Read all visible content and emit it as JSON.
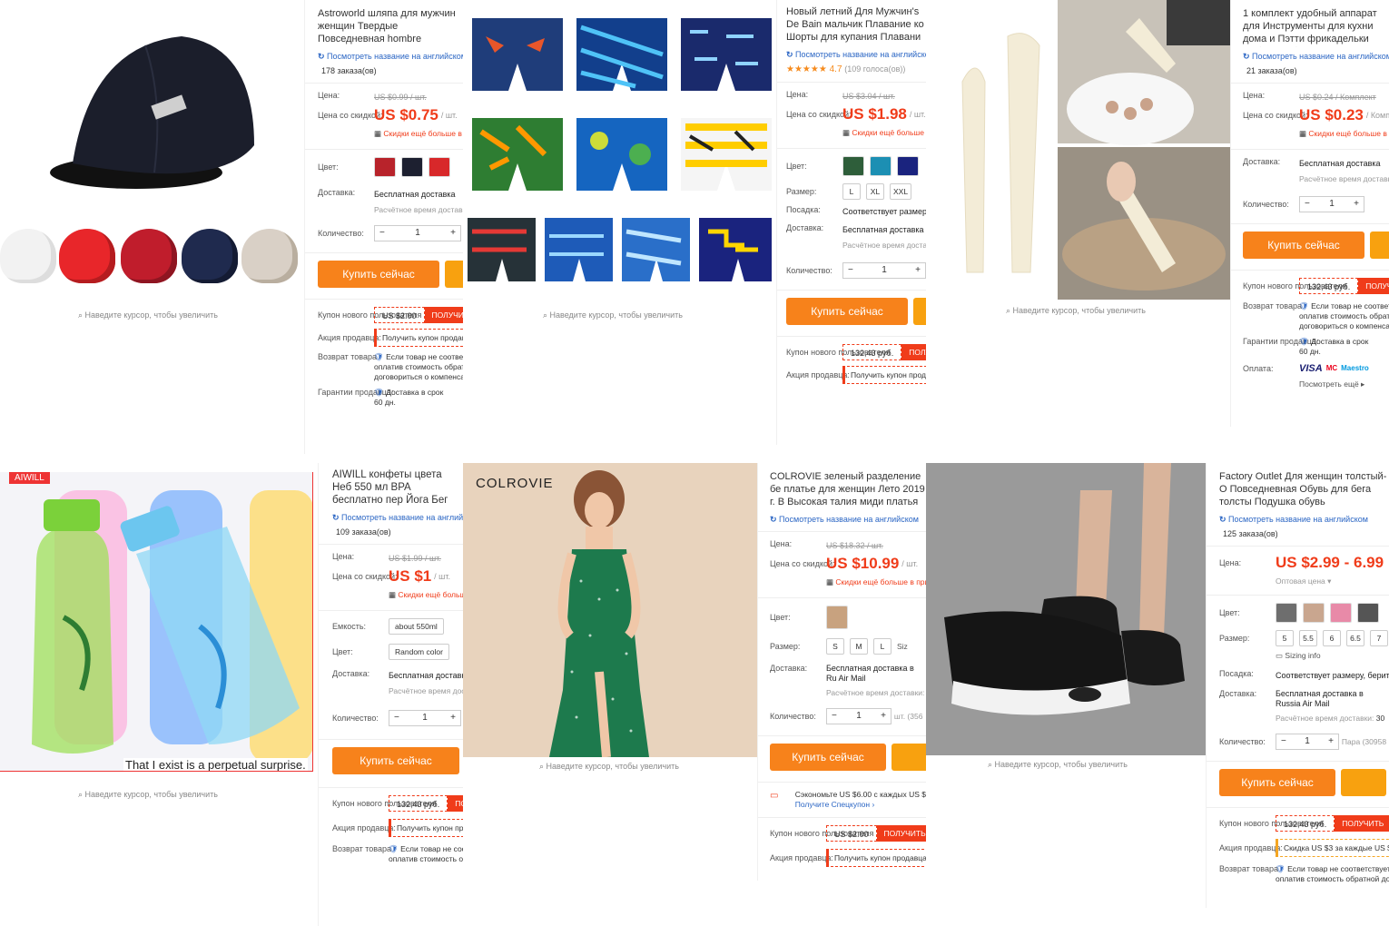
{
  "common": {
    "zoom_hint": "Наведите курсор, чтобы увеличить",
    "translate_link": "Посмотреть название на английском",
    "price_label": "Цена:",
    "discount_price_label": "Цена со скидкой:",
    "color_label": "Цвет:",
    "size_label": "Размер:",
    "fit_label": "Посадка:",
    "delivery_label": "Доставка:",
    "quantity_label": "Количество:",
    "buy_now": "Купить сейчас",
    "new_user_coupon_label": "Купон нового пользователя",
    "seller_promo_label": "Акция продавца:",
    "return_label": "Возврат товара",
    "guarantee_label": "Гарантии продавца:",
    "payment_label": "Оплата:",
    "free_delivery": "Бесплатная доставка",
    "delivery_time": "Расчётное время доставки:",
    "more_discounts": "Скидки ещё больше в приложении",
    "qty_minus": "−",
    "qty_plus": "+",
    "qty_value": "1",
    "get_coupon": "ПОЛУЧИТЬ",
    "return_text_1": "Если товар не соответствует описанию,",
    "return_text_2": "оплатив стоимость обратной доставки или",
    "return_text_3": "договориться о компенсации",
    "guarantee_text_1": "Доставка в срок",
    "guarantee_text_2": "60 дн.",
    "see_more": "Посмотреть ещё ▸",
    "sizing_info": "Sizing info",
    "seller_promo_btn": "Получить купон продавца"
  },
  "products": [
    {
      "id": "cap",
      "title": "Astroworld шляпа для мужчин женщин Твердые Повседневная hombre",
      "orders": "178 заказа(ов)",
      "old_price": "US $0.99 / шт.",
      "price": "US $0.75",
      "unit": "/ шт.",
      "swatch_colors": [
        "#b8232b",
        "#1d2030",
        "#d8282a"
      ],
      "thumb_colors": [
        "#f2f2f2",
        "#e8262a",
        "#c01d2c",
        "#1f2a4e",
        "#d9d0c6"
      ],
      "coupon": "US $2.00"
    },
    {
      "id": "shorts",
      "title": "Новый летний Для Мужчин's De Bain мальчик Плавание ко Шорты для купания Плавани",
      "rating": "★★★★★",
      "score": "4.7",
      "reviews": "(109 голоса(ов))",
      "old_price": "US $3.04 / шт.",
      "price": "US $1.98",
      "unit": "/ шт.",
      "sizes": [
        "L",
        "XL",
        "XXL"
      ],
      "fit_value": "Соответствует размеру",
      "coupon": "132,43 руб."
    },
    {
      "id": "kitchen",
      "title": "1 комплект удобный аппарат для Инструменты для кухни дома и Пэтти фрикадельки рыбы мяч б",
      "orders": "21 заказа(ов)",
      "old_price": "US $0.24 / Комплект",
      "price": "US $0.23",
      "unit": "/ Комплект",
      "coupon": "132,43 руб.",
      "cards": [
        "VISA",
        "MC",
        "Maestro"
      ]
    },
    {
      "id": "bottle",
      "title": "AIWILL конфеты цвета Неб 550 мл BPA бесплатно пер Йога Бег кемпинг",
      "brand_stamp": "AIWILL",
      "caption": "That I exist is a perpetual surprise.",
      "orders": "109 заказа(ов)",
      "capacity_label": "Емкость:",
      "capacity_value": "about 550ml",
      "color_value": "Random color",
      "old_price": "US $1.99 / шт.",
      "price": "US $1",
      "unit": "/ шт.",
      "coupon": "132,43 руб."
    },
    {
      "id": "dress",
      "brand_stamp": "COLROVIE",
      "title": "COLROVIE зеленый разделение бе платье для женщин Лето 2019 г. В Высокая талия миди платья",
      "old_price": "US $18.32 / шт.",
      "price": "US $10.99",
      "unit": "/ шт.",
      "sizes": [
        "S",
        "M",
        "L"
      ],
      "sizing_short": "Siz",
      "delivery_text": "Бесплатная доставка в Ru Air Mail",
      "qty_note": "шт. (356",
      "save_text": "Сэкономьте US $6.00 с каждых US $",
      "special_coupon": "Получите Спецкупон ›",
      "coupon": "US $2.00"
    },
    {
      "id": "shoes",
      "title": "Factory Outlet Для женщин толстый-О Повседневная Обувь для бега толсты Подушка обувь",
      "orders": "125 заказа(ов)",
      "price": "US $2.99 - 6.99",
      "wholesale": "Оптовая цена ▾",
      "sizes": [
        "5",
        "5.5",
        "6",
        "6.5",
        "7"
      ],
      "fit_value": "Соответствует размеру, берите",
      "delivery_text": "Бесплатная доставка в Russia Air Mail",
      "delivery_days": "30",
      "qty_note": "Пара (30958",
      "coupon": "132,43 руб.",
      "promo": "Скидка US $3 за каждые US $"
    }
  ]
}
